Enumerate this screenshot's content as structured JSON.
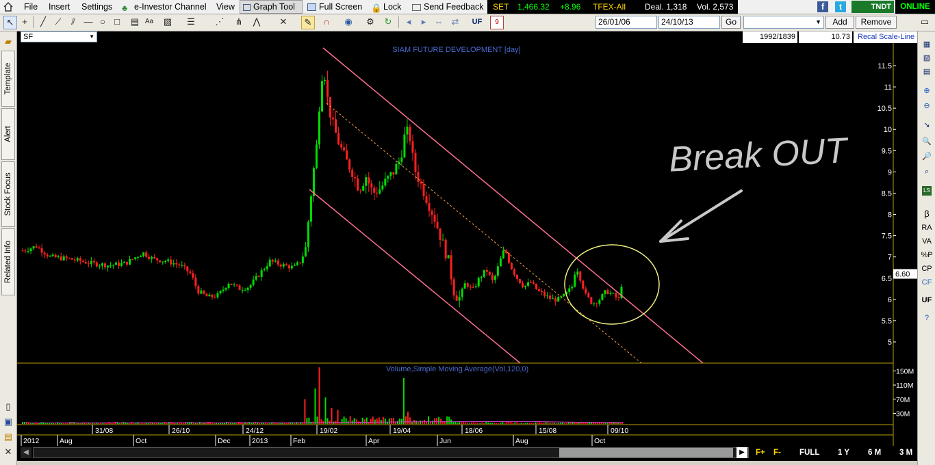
{
  "menubar": {
    "items": [
      "File",
      "Insert",
      "Settings",
      "e-Investor Channel",
      "View",
      "Graph Tool",
      "Full Screen",
      "Lock",
      "Send Feedback"
    ],
    "ticker": {
      "set_label": "SET",
      "set_value": "1,466.32",
      "set_change": "+8.96",
      "tfex_label": "TFEX-All",
      "deal": "Deal. 1,318",
      "vol": "Vol. 2,573"
    },
    "status": "ONLINE",
    "tndt": "TNDT"
  },
  "toolbar": {
    "uf_label": "UF",
    "date_from": "26/01/06",
    "date_to": "24/10/13",
    "go_label": "Go",
    "add_label": "Add",
    "remove_label": "Remove",
    "cal_day": "9"
  },
  "info": {
    "symbol": "SF",
    "range": "1992/1839",
    "value": "10.73",
    "recal_label": "Recal Scale-Line"
  },
  "left_tabs": [
    "Template",
    "Alert",
    "Stock Focus",
    "Related Info"
  ],
  "right_tools": [
    "β",
    "RA",
    "VA",
    "%P",
    "CP",
    "CF",
    "UF"
  ],
  "chart_data": {
    "type": "candlestick",
    "title": "SIAM FUTURE DEVELOPMENT [day]",
    "price_ticks": [
      "11.5",
      "11",
      "10.5",
      "10",
      "9.5",
      "9",
      "8.5",
      "8",
      "7.5",
      "7",
      "6.5",
      "6",
      "5.5",
      "5"
    ],
    "price_range": [
      4.5,
      12.0
    ],
    "last_price": "6.60",
    "volume_title": "Volume,Simple Moving Average(Vol,120,0)",
    "volume_ticks": [
      "150M",
      "110M",
      "70M",
      "30M"
    ],
    "date_ticks_top": [
      "31/08",
      "26/10",
      "24/12",
      "19/02",
      "19/04",
      "18/06",
      "15/08",
      "09/10"
    ],
    "date_ticks_bottom": [
      "2012",
      "Aug",
      "Oct",
      "Dec",
      "2013",
      "Feb",
      "Apr",
      "Jun",
      "Aug",
      "Oct"
    ],
    "price_path": [
      {
        "t": 0,
        "p": 7.15
      },
      {
        "t": 20,
        "p": 7.25
      },
      {
        "t": 40,
        "p": 7.0
      },
      {
        "t": 70,
        "p": 6.95
      },
      {
        "t": 100,
        "p": 6.85
      },
      {
        "t": 125,
        "p": 6.8
      },
      {
        "t": 150,
        "p": 6.85
      },
      {
        "t": 175,
        "p": 7.1
      },
      {
        "t": 190,
        "p": 6.95
      },
      {
        "t": 210,
        "p": 6.9
      },
      {
        "t": 230,
        "p": 6.8
      },
      {
        "t": 245,
        "p": 6.6
      },
      {
        "t": 255,
        "p": 6.2
      },
      {
        "t": 270,
        "p": 6.05
      },
      {
        "t": 285,
        "p": 6.1
      },
      {
        "t": 300,
        "p": 6.4
      },
      {
        "t": 315,
        "p": 6.25
      },
      {
        "t": 330,
        "p": 6.3
      },
      {
        "t": 345,
        "p": 6.6
      },
      {
        "t": 360,
        "p": 6.9
      },
      {
        "t": 380,
        "p": 6.8
      },
      {
        "t": 395,
        "p": 6.75
      },
      {
        "t": 405,
        "p": 6.9
      },
      {
        "t": 412,
        "p": 7.2
      },
      {
        "t": 417,
        "p": 8.0
      },
      {
        "t": 422,
        "p": 8.8
      },
      {
        "t": 428,
        "p": 9.6
      },
      {
        "t": 433,
        "p": 10.8
      },
      {
        "t": 438,
        "p": 11.6
      },
      {
        "t": 443,
        "p": 10.8
      },
      {
        "t": 450,
        "p": 10.2
      },
      {
        "t": 460,
        "p": 9.7
      },
      {
        "t": 470,
        "p": 9.3
      },
      {
        "t": 480,
        "p": 9.0
      },
      {
        "t": 490,
        "p": 8.6
      },
      {
        "t": 500,
        "p": 8.9
      },
      {
        "t": 510,
        "p": 8.5
      },
      {
        "t": 520,
        "p": 8.6
      },
      {
        "t": 530,
        "p": 8.8
      },
      {
        "t": 540,
        "p": 9.0
      },
      {
        "t": 550,
        "p": 9.3
      },
      {
        "t": 558,
        "p": 10.0
      },
      {
        "t": 564,
        "p": 9.8
      },
      {
        "t": 570,
        "p": 9.1
      },
      {
        "t": 580,
        "p": 8.7
      },
      {
        "t": 590,
        "p": 8.3
      },
      {
        "t": 600,
        "p": 7.9
      },
      {
        "t": 610,
        "p": 7.4
      },
      {
        "t": 620,
        "p": 6.9
      },
      {
        "t": 628,
        "p": 6.2
      },
      {
        "t": 635,
        "p": 6.0
      },
      {
        "t": 645,
        "p": 6.4
      },
      {
        "t": 655,
        "p": 6.2
      },
      {
        "t": 665,
        "p": 6.5
      },
      {
        "t": 675,
        "p": 6.7
      },
      {
        "t": 685,
        "p": 6.4
      },
      {
        "t": 695,
        "p": 6.9
      },
      {
        "t": 702,
        "p": 7.2
      },
      {
        "t": 710,
        "p": 6.8
      },
      {
        "t": 720,
        "p": 6.5
      },
      {
        "t": 730,
        "p": 6.3
      },
      {
        "t": 740,
        "p": 6.4
      },
      {
        "t": 750,
        "p": 6.2
      },
      {
        "t": 760,
        "p": 6.1
      },
      {
        "t": 770,
        "p": 6.0
      },
      {
        "t": 780,
        "p": 6.0
      },
      {
        "t": 790,
        "p": 6.1
      },
      {
        "t": 800,
        "p": 6.3
      },
      {
        "t": 806,
        "p": 6.8
      },
      {
        "t": 812,
        "p": 6.5
      },
      {
        "t": 820,
        "p": 6.1
      },
      {
        "t": 830,
        "p": 5.9
      },
      {
        "t": 840,
        "p": 6.0
      },
      {
        "t": 850,
        "p": 6.2
      },
      {
        "t": 860,
        "p": 6.1
      },
      {
        "t": 868,
        "p": 6.0
      },
      {
        "t": 875,
        "p": 6.6
      }
    ],
    "volume_spikes": [
      {
        "t": 412,
        "v": 70
      },
      {
        "t": 425,
        "v": 100
      },
      {
        "t": 433,
        "v": 160
      },
      {
        "t": 440,
        "v": 75
      },
      {
        "t": 450,
        "v": 45
      },
      {
        "t": 460,
        "v": 40
      },
      {
        "t": 555,
        "v": 130
      },
      {
        "t": 562,
        "v": 35
      },
      {
        "t": 610,
        "v": 15
      },
      {
        "t": 875,
        "v": 18
      }
    ],
    "annotations": {
      "breakout_text": "Break OUT"
    }
  }
}
